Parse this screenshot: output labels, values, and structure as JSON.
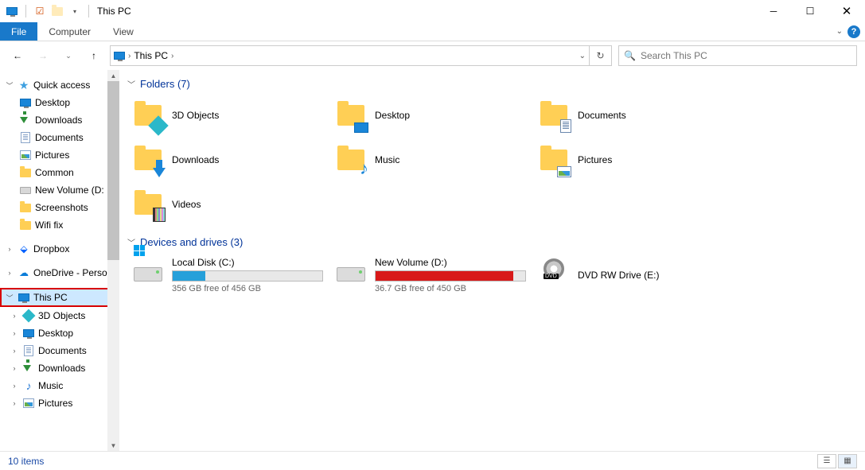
{
  "window": {
    "title": "This PC"
  },
  "ribbon": {
    "file": "File",
    "computer": "Computer",
    "view": "View"
  },
  "nav": {
    "breadcrumb": "This PC",
    "search_placeholder": "Search This PC"
  },
  "sidebar": {
    "quick_access": {
      "label": "Quick access",
      "items": [
        {
          "label": "Desktop",
          "icon": "monitor",
          "pinned": true
        },
        {
          "label": "Downloads",
          "icon": "arrowdn",
          "pinned": true
        },
        {
          "label": "Documents",
          "icon": "doc",
          "pinned": true
        },
        {
          "label": "Pictures",
          "icon": "pic",
          "pinned": true
        },
        {
          "label": "Common",
          "icon": "folder",
          "pinned": false
        },
        {
          "label": "New Volume (D:",
          "icon": "drive",
          "pinned": false
        },
        {
          "label": "Screenshots",
          "icon": "folder",
          "pinned": false
        },
        {
          "label": "Wifi fix",
          "icon": "folder",
          "pinned": false
        }
      ]
    },
    "dropbox": {
      "label": "Dropbox"
    },
    "onedrive": {
      "label": "OneDrive - Person"
    },
    "this_pc": {
      "label": "This PC",
      "items": [
        {
          "label": "3D Objects",
          "icon": "3d"
        },
        {
          "label": "Desktop",
          "icon": "monitor"
        },
        {
          "label": "Documents",
          "icon": "doc"
        },
        {
          "label": "Downloads",
          "icon": "arrowdn"
        },
        {
          "label": "Music",
          "icon": "music"
        },
        {
          "label": "Pictures",
          "icon": "pic"
        }
      ]
    }
  },
  "content": {
    "folders_header": "Folders (7)",
    "folders": [
      {
        "label": "3D Objects",
        "overlay": "3d"
      },
      {
        "label": "Desktop",
        "overlay": "monitor"
      },
      {
        "label": "Documents",
        "overlay": "doc"
      },
      {
        "label": "Downloads",
        "overlay": "arrow"
      },
      {
        "label": "Music",
        "overlay": "music"
      },
      {
        "label": "Pictures",
        "overlay": "pic"
      },
      {
        "label": "Videos",
        "overlay": "film"
      }
    ],
    "drives_header": "Devices and drives (3)",
    "drives": [
      {
        "label": "Local Disk (C:)",
        "free_text": "356 GB free of 456 GB",
        "fill_pct": 22,
        "color": "#26a0da",
        "icon": "win"
      },
      {
        "label": "New Volume (D:)",
        "free_text": "36.7 GB free of 450 GB",
        "fill_pct": 92,
        "color": "#d81a1a",
        "icon": "plain"
      },
      {
        "label": "DVD RW Drive (E:)",
        "free_text": "",
        "fill_pct": 0,
        "color": "",
        "icon": "dvd"
      }
    ]
  },
  "status": {
    "text": "10 items"
  }
}
